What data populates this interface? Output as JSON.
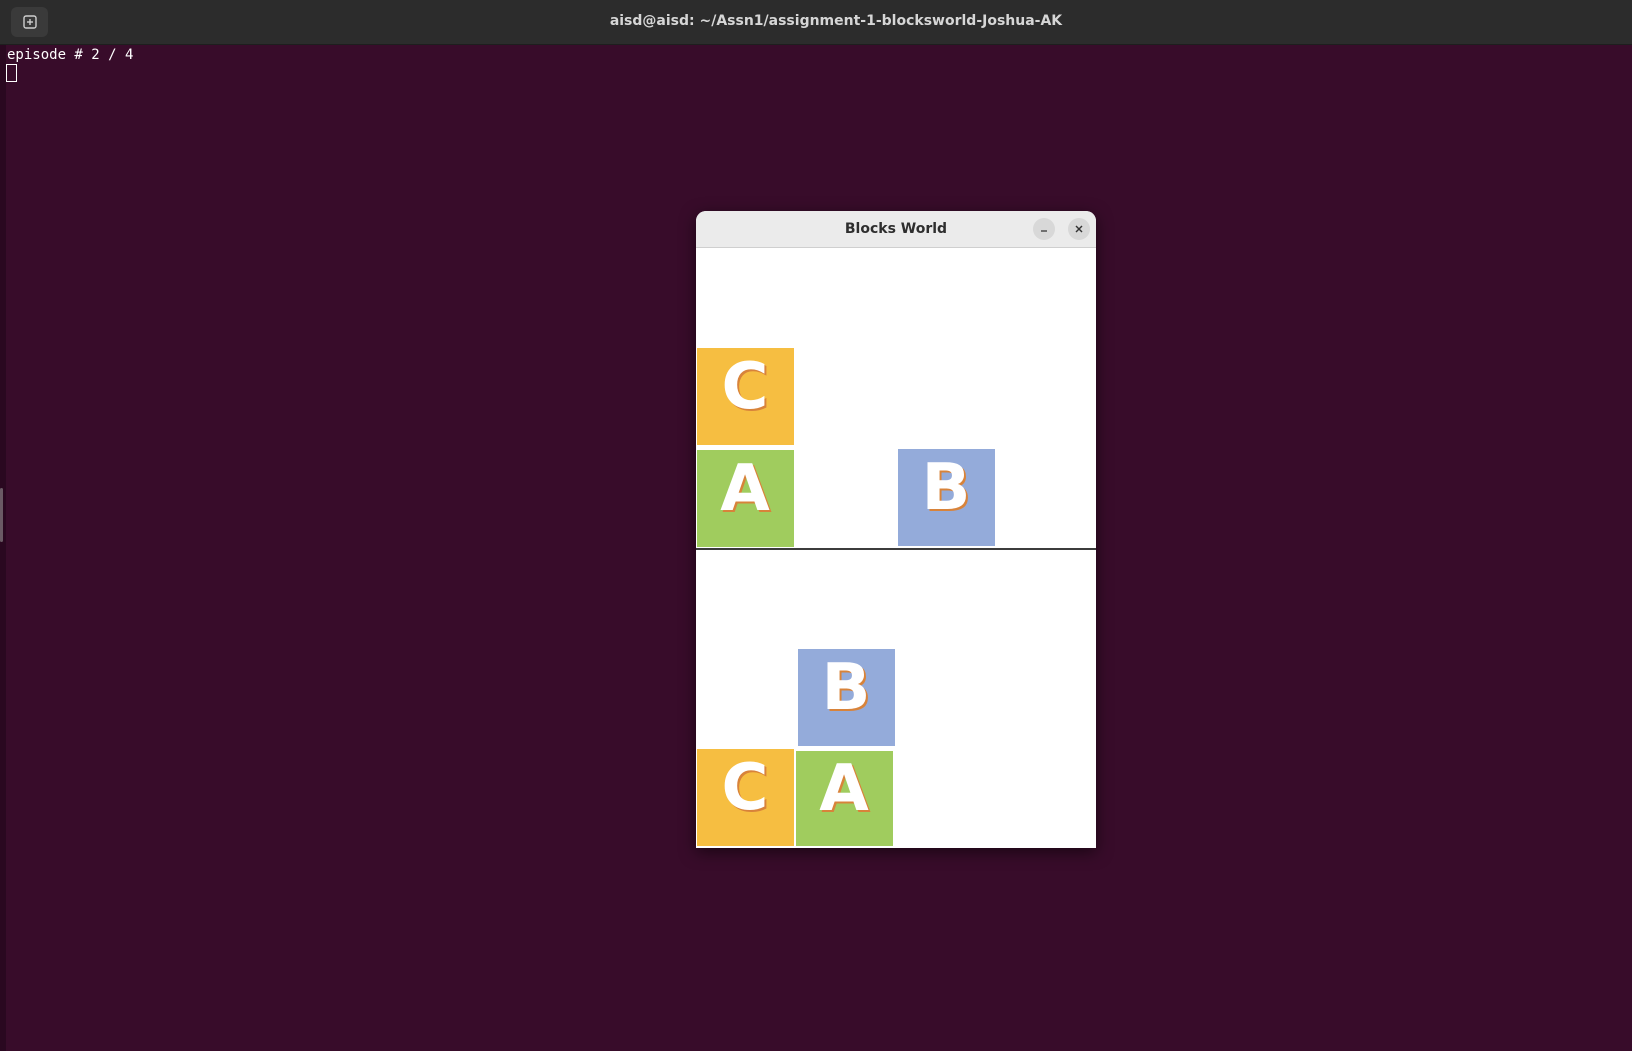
{
  "terminal": {
    "title": "aisd@aisd: ~/Assn1/assignment-1-blocksworld-Joshua-AK",
    "output_line": "episode # 2 / 4"
  },
  "blocks_world": {
    "title": "Blocks World",
    "colors": {
      "orange": "#f6be41",
      "green": "#a0cc5e",
      "blue": "#94abda",
      "letter_fill": "#ffffff",
      "letter_shadow": "#d8833a"
    },
    "current_state": {
      "blocks": [
        {
          "letter": "C",
          "color": "orange"
        },
        {
          "letter": "A",
          "color": "green"
        },
        {
          "letter": "B",
          "color": "blue"
        }
      ]
    },
    "goal_state": {
      "blocks": [
        {
          "letter": "B",
          "color": "blue"
        },
        {
          "letter": "C",
          "color": "orange"
        },
        {
          "letter": "A",
          "color": "green"
        }
      ]
    }
  }
}
